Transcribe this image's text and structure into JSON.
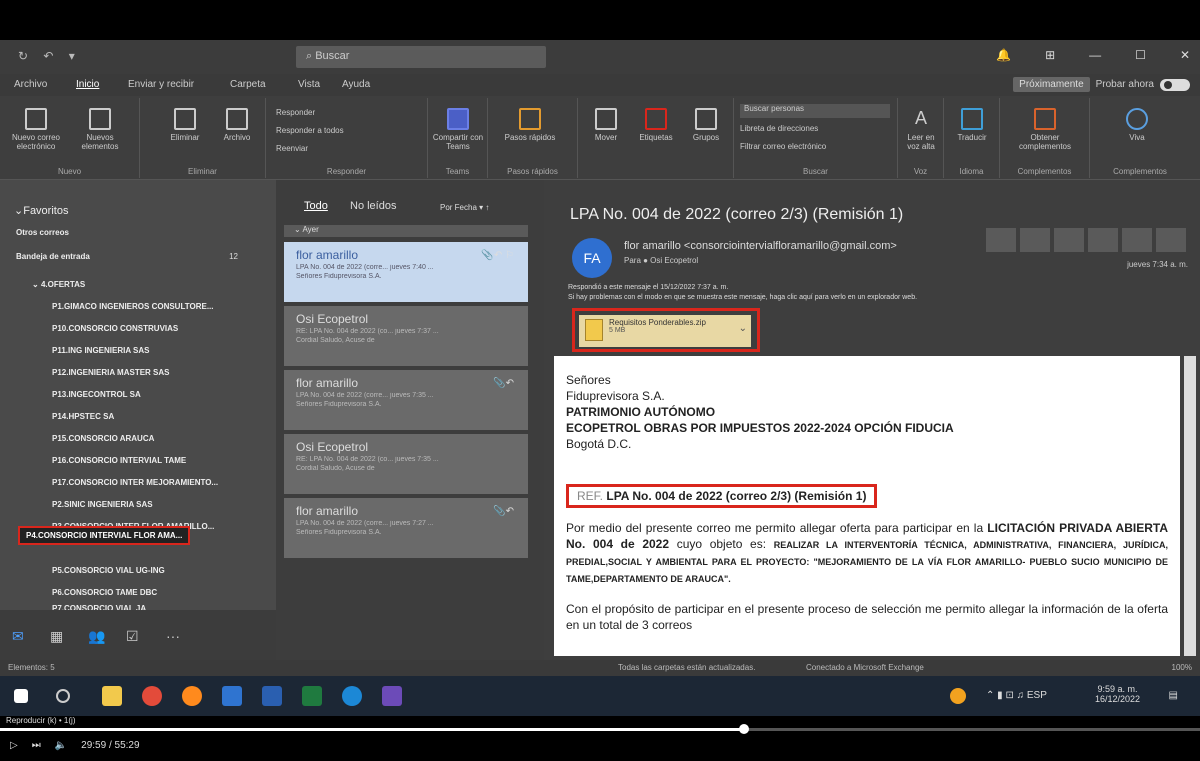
{
  "window": {
    "quick_access": "↻ ↶ ▾",
    "search_placeholder": "Buscar",
    "controls": [
      "🔔",
      "⊞",
      "—",
      "☐",
      "✕"
    ]
  },
  "menu": {
    "items": [
      "Archivo",
      "Inicio",
      "Enviar y recibir",
      "Carpeta",
      "Vista",
      "Ayuda"
    ],
    "active": "Inicio",
    "pill": "Próximamente",
    "try_now": "Probar ahora"
  },
  "ribbon": {
    "groups": [
      {
        "label": "Nuevo",
        "buttons": [
          "Nuevo correo electrónico",
          "Nuevos elementos"
        ]
      },
      {
        "label": "Eliminar",
        "buttons": [
          "Eliminar",
          "Archivo"
        ]
      },
      {
        "label": "Responder",
        "buttons": [
          "Responder",
          "Responder a todos",
          "Reenviar"
        ]
      },
      {
        "label": "Teams",
        "buttons": [
          "Compartir con Teams"
        ]
      },
      {
        "label": "Pasos rápidos",
        "buttons": [
          "Pasos rápidos"
        ]
      },
      {
        "label": "",
        "buttons": [
          "Mover",
          "Etiquetas",
          "Grupos"
        ]
      },
      {
        "label": "Buscar",
        "buttons": [
          "Buscar personas",
          "Libreta de direcciones",
          "Filtrar correo electrónico"
        ]
      },
      {
        "label": "Voz",
        "buttons": [
          "Leer en voz alta"
        ]
      },
      {
        "label": "Idioma",
        "buttons": [
          "Traducir"
        ]
      },
      {
        "label": "Complementos",
        "buttons": [
          "Obtener complementos"
        ]
      },
      {
        "label": "Complementos",
        "buttons": [
          "Viva"
        ]
      }
    ]
  },
  "folders": {
    "favorites_label": "Favoritos",
    "items": [
      {
        "label": "Otros correos",
        "sub": false
      },
      {
        "label": "Bandeja de entrada",
        "sub": false,
        "count": "12"
      },
      {
        "label": "4.OFERTAS",
        "sub": true,
        "indent": 30
      },
      {
        "label": "P1.GIMACO INGENIEROS CONSULTORE...",
        "sub": true
      },
      {
        "label": "P10.CONSORCIO CONSTRUVIAS",
        "sub": true
      },
      {
        "label": "P11.ING INGENIERIA SAS",
        "sub": true
      },
      {
        "label": "P12.INGENIERIA MASTER SAS",
        "sub": true
      },
      {
        "label": "P13.INGECONTROL SA",
        "sub": true
      },
      {
        "label": "P14.HPSTEC SA",
        "sub": true
      },
      {
        "label": "P15.CONSORCIO ARAUCA",
        "sub": true
      },
      {
        "label": "P16.CONSORCIO INTERVIAL TAME",
        "sub": true
      },
      {
        "label": "P17.CONSORCIO INTER MEJORAMIENTO...",
        "sub": true
      },
      {
        "label": "P2.SINIC INGENIERIA SAS",
        "sub": true
      },
      {
        "label": "P3.CONSORCIO INTER FLOR AMARILLO...",
        "sub": true
      },
      {
        "label": "P4.CONSORCIO INTERVIAL FLOR AMA...",
        "sub": true,
        "highlight": true
      },
      {
        "label": "P5.CONSORCIO VIAL UG-ING",
        "sub": true
      },
      {
        "label": "P6.CONSORCIO TAME DBC",
        "sub": true
      },
      {
        "label": "P7.CONSORCIO VIAL JA",
        "sub": true
      }
    ]
  },
  "nav": [
    "✉",
    "▦",
    "👥",
    "☑",
    "···"
  ],
  "list": {
    "tab_all": "Todo",
    "tab_unread": "No leídos",
    "sort": "Por Fecha ▾  ↑",
    "group": "Ayer",
    "messages": [
      {
        "from": "flor amarillo",
        "subject": "LPA No. 004 de 2022 (corre...",
        "date": "jueves 7:40 ...",
        "preview": "Señores Fiduprevisora S.A.",
        "selected": true
      },
      {
        "from": "Osi Ecopetrol",
        "subject": "RE: LPA No. 004 de 2022 (co...",
        "date": "jueves 7:37 ...",
        "preview": "Cordial Saludo,   Acuse de",
        "selected": false
      },
      {
        "from": "flor amarillo",
        "subject": "LPA No. 004 de 2022 (corre...",
        "date": "jueves 7:35 ...",
        "preview": "Señores Fiduprevisora S.A.",
        "selected": false
      },
      {
        "from": "Osi Ecopetrol",
        "subject": "RE: LPA No. 004 de 2022 (co...",
        "date": "jueves 7:35 ...",
        "preview": "Cordial Saludo,   Acuse de",
        "selected": false
      },
      {
        "from": "flor amarillo",
        "subject": "LPA No. 004 de 2022 (corre...",
        "date": "jueves 7:27 ...",
        "preview": "Señores Fiduprevisora S.A.",
        "selected": false
      }
    ]
  },
  "reading": {
    "title": "LPA No. 004 de 2022 (correo 2/3) (Remisión 1)",
    "initials": "FA",
    "sender": "flor amarillo <consorciointervialfloramarillo@gmail.com>",
    "to": "Para  ● Osi Ecopetrol",
    "date": "jueves 7:34 a. m.",
    "info1": "Respondió a este mensaje el 15/12/2022 7:37 a. m.",
    "info2": "Si hay problemas con el modo en que se muestra este mensaje, haga clic aquí para verlo en un explorador web.",
    "attachment": {
      "name": "Requisitos Ponderables.zip",
      "size": "5 MB"
    },
    "body": {
      "greeting": "Señores",
      "l1": "Fiduprevisora S.A.",
      "l2": "PATRIMONIO AUTÓNOMO",
      "l3": "ECOPETROL OBRAS POR IMPUESTOS 2022-2024 OPCIÓN FIDUCIA",
      "l4": "Bogotá D.C.",
      "ref_label": "REF.",
      "ref_text": "LPA No. 004 de 2022 (correo 2/3) (Remisión 1)",
      "p1a": "Por medio del presente correo me permito allegar oferta para participar en la ",
      "p1b": "LICITACIÓN PRIVADA ABIERTA No. 004 de 2022",
      "p1c": " cuyo objeto es: ",
      "p1d": "REALIZAR LA INTERVENTORÍA TÉCNICA, ADMINISTRATIVA, FINANCIERA, JURÍDICA, PREDIAL,SOCIAL Y AMBIENTAL PARA EL PROYECTO: \"MEJORAMIENTO DE LA VÍA FLOR AMARILLO- PUEBLO SUCIO MUNICIPIO DE TAME,DEPARTAMENTO DE ARAUCA\".",
      "p2": "Con el propósito de participar en el presente proceso de selección me permito allegar la información de la oferta en un total de 3 correos"
    }
  },
  "status": {
    "items": "Elementos: 5",
    "sync": "Todas las carpetas están actualizadas.",
    "conn": "Conectado a Microsoft Exchange",
    "zoom": "100%"
  },
  "taskbar": {
    "time": "9:59 a. m.",
    "date": "16/12/2022"
  },
  "player": {
    "label": "Reproducir (k) • 1(j)",
    "time": "29:59 / 55:29",
    "progress": 0.62
  }
}
